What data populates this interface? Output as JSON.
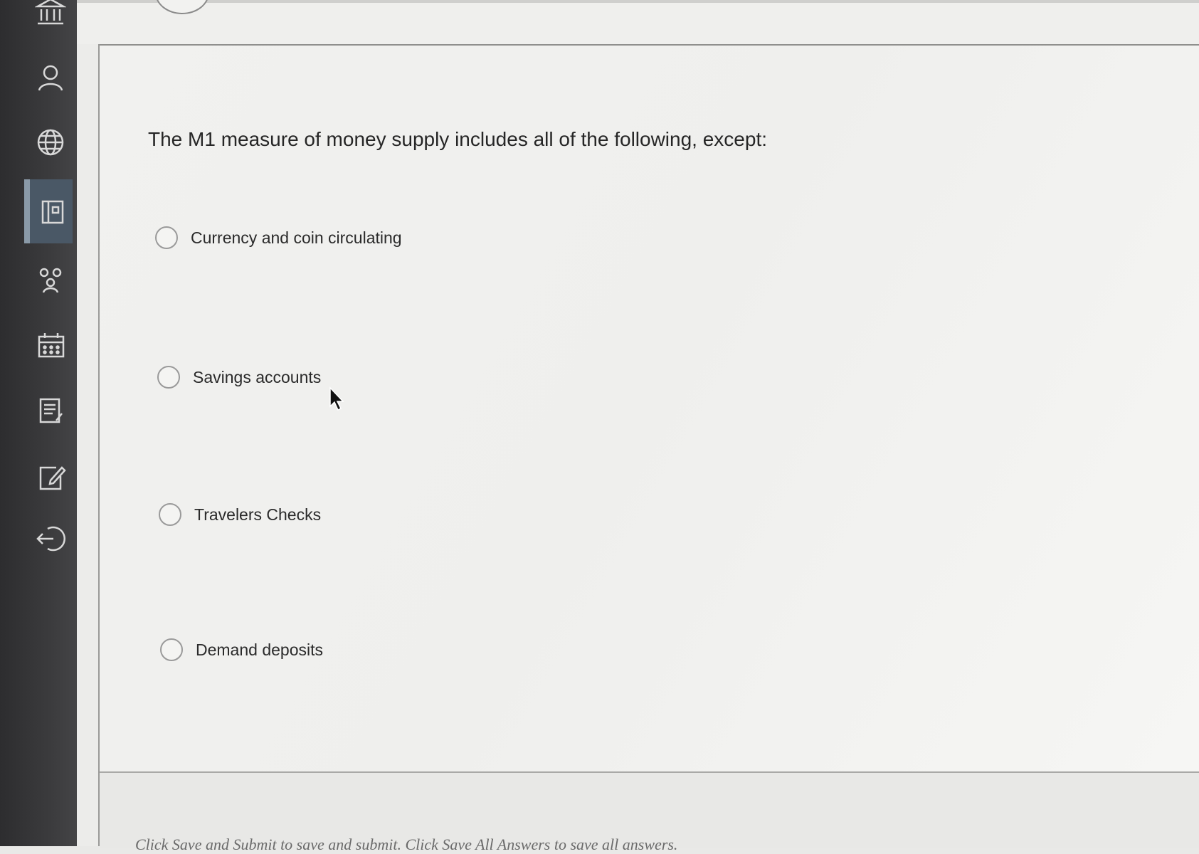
{
  "sidebar": {
    "items": [
      {
        "icon": "institution-icon"
      },
      {
        "icon": "user-icon"
      },
      {
        "icon": "globe-icon"
      },
      {
        "icon": "course-icon",
        "active": true
      },
      {
        "icon": "groups-icon"
      },
      {
        "icon": "calendar-icon"
      },
      {
        "icon": "grades-icon"
      },
      {
        "icon": "edit-icon"
      },
      {
        "icon": "sign-out-icon"
      }
    ]
  },
  "question": {
    "text": "The M1 measure of money supply includes all of the following, except:",
    "options": [
      {
        "label": "Currency and coin circulating"
      },
      {
        "label": "Savings accounts"
      },
      {
        "label": "Travelers Checks"
      },
      {
        "label": "Demand deposits"
      }
    ]
  },
  "footer": {
    "text": "Click Save and Submit to save and submit. Click Save All Answers to save all answers."
  },
  "colors": {
    "sidebar": "#3a3a3c",
    "active_item": "#4a5866",
    "page_background": "#f0f0ee"
  }
}
